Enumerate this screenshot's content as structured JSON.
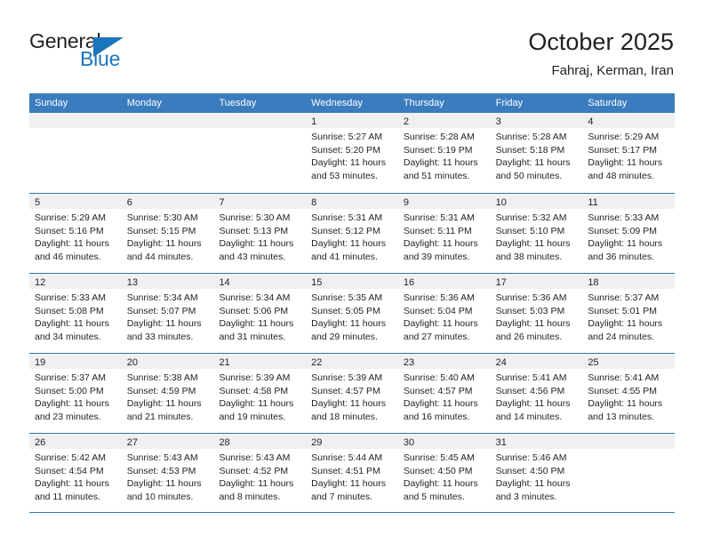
{
  "header": {
    "logo": {
      "word1": "General",
      "word2": "Blue",
      "accent_color": "#1b75bb"
    },
    "title": "October 2025",
    "subtitle": "Fahraj, Kerman, Iran"
  },
  "calendar": {
    "header_bg": "#3a7cbe",
    "grid_line_color": "#2f74b5",
    "daynum_bg": "#f0f0f0",
    "weekdays": [
      "Sunday",
      "Monday",
      "Tuesday",
      "Wednesday",
      "Thursday",
      "Friday",
      "Saturday"
    ],
    "weeks": [
      [
        {
          "day": "",
          "lines": []
        },
        {
          "day": "",
          "lines": []
        },
        {
          "day": "",
          "lines": []
        },
        {
          "day": "1",
          "lines": [
            "Sunrise: 5:27 AM",
            "Sunset: 5:20 PM",
            "Daylight: 11 hours",
            "and 53 minutes."
          ]
        },
        {
          "day": "2",
          "lines": [
            "Sunrise: 5:28 AM",
            "Sunset: 5:19 PM",
            "Daylight: 11 hours",
            "and 51 minutes."
          ]
        },
        {
          "day": "3",
          "lines": [
            "Sunrise: 5:28 AM",
            "Sunset: 5:18 PM",
            "Daylight: 11 hours",
            "and 50 minutes."
          ]
        },
        {
          "day": "4",
          "lines": [
            "Sunrise: 5:29 AM",
            "Sunset: 5:17 PM",
            "Daylight: 11 hours",
            "and 48 minutes."
          ]
        }
      ],
      [
        {
          "day": "5",
          "lines": [
            "Sunrise: 5:29 AM",
            "Sunset: 5:16 PM",
            "Daylight: 11 hours",
            "and 46 minutes."
          ]
        },
        {
          "day": "6",
          "lines": [
            "Sunrise: 5:30 AM",
            "Sunset: 5:15 PM",
            "Daylight: 11 hours",
            "and 44 minutes."
          ]
        },
        {
          "day": "7",
          "lines": [
            "Sunrise: 5:30 AM",
            "Sunset: 5:13 PM",
            "Daylight: 11 hours",
            "and 43 minutes."
          ]
        },
        {
          "day": "8",
          "lines": [
            "Sunrise: 5:31 AM",
            "Sunset: 5:12 PM",
            "Daylight: 11 hours",
            "and 41 minutes."
          ]
        },
        {
          "day": "9",
          "lines": [
            "Sunrise: 5:31 AM",
            "Sunset: 5:11 PM",
            "Daylight: 11 hours",
            "and 39 minutes."
          ]
        },
        {
          "day": "10",
          "lines": [
            "Sunrise: 5:32 AM",
            "Sunset: 5:10 PM",
            "Daylight: 11 hours",
            "and 38 minutes."
          ]
        },
        {
          "day": "11",
          "lines": [
            "Sunrise: 5:33 AM",
            "Sunset: 5:09 PM",
            "Daylight: 11 hours",
            "and 36 minutes."
          ]
        }
      ],
      [
        {
          "day": "12",
          "lines": [
            "Sunrise: 5:33 AM",
            "Sunset: 5:08 PM",
            "Daylight: 11 hours",
            "and 34 minutes."
          ]
        },
        {
          "day": "13",
          "lines": [
            "Sunrise: 5:34 AM",
            "Sunset: 5:07 PM",
            "Daylight: 11 hours",
            "and 33 minutes."
          ]
        },
        {
          "day": "14",
          "lines": [
            "Sunrise: 5:34 AM",
            "Sunset: 5:06 PM",
            "Daylight: 11 hours",
            "and 31 minutes."
          ]
        },
        {
          "day": "15",
          "lines": [
            "Sunrise: 5:35 AM",
            "Sunset: 5:05 PM",
            "Daylight: 11 hours",
            "and 29 minutes."
          ]
        },
        {
          "day": "16",
          "lines": [
            "Sunrise: 5:36 AM",
            "Sunset: 5:04 PM",
            "Daylight: 11 hours",
            "and 27 minutes."
          ]
        },
        {
          "day": "17",
          "lines": [
            "Sunrise: 5:36 AM",
            "Sunset: 5:03 PM",
            "Daylight: 11 hours",
            "and 26 minutes."
          ]
        },
        {
          "day": "18",
          "lines": [
            "Sunrise: 5:37 AM",
            "Sunset: 5:01 PM",
            "Daylight: 11 hours",
            "and 24 minutes."
          ]
        }
      ],
      [
        {
          "day": "19",
          "lines": [
            "Sunrise: 5:37 AM",
            "Sunset: 5:00 PM",
            "Daylight: 11 hours",
            "and 23 minutes."
          ]
        },
        {
          "day": "20",
          "lines": [
            "Sunrise: 5:38 AM",
            "Sunset: 4:59 PM",
            "Daylight: 11 hours",
            "and 21 minutes."
          ]
        },
        {
          "day": "21",
          "lines": [
            "Sunrise: 5:39 AM",
            "Sunset: 4:58 PM",
            "Daylight: 11 hours",
            "and 19 minutes."
          ]
        },
        {
          "day": "22",
          "lines": [
            "Sunrise: 5:39 AM",
            "Sunset: 4:57 PM",
            "Daylight: 11 hours",
            "and 18 minutes."
          ]
        },
        {
          "day": "23",
          "lines": [
            "Sunrise: 5:40 AM",
            "Sunset: 4:57 PM",
            "Daylight: 11 hours",
            "and 16 minutes."
          ]
        },
        {
          "day": "24",
          "lines": [
            "Sunrise: 5:41 AM",
            "Sunset: 4:56 PM",
            "Daylight: 11 hours",
            "and 14 minutes."
          ]
        },
        {
          "day": "25",
          "lines": [
            "Sunrise: 5:41 AM",
            "Sunset: 4:55 PM",
            "Daylight: 11 hours",
            "and 13 minutes."
          ]
        }
      ],
      [
        {
          "day": "26",
          "lines": [
            "Sunrise: 5:42 AM",
            "Sunset: 4:54 PM",
            "Daylight: 11 hours",
            "and 11 minutes."
          ]
        },
        {
          "day": "27",
          "lines": [
            "Sunrise: 5:43 AM",
            "Sunset: 4:53 PM",
            "Daylight: 11 hours",
            "and 10 minutes."
          ]
        },
        {
          "day": "28",
          "lines": [
            "Sunrise: 5:43 AM",
            "Sunset: 4:52 PM",
            "Daylight: 11 hours",
            "and 8 minutes."
          ]
        },
        {
          "day": "29",
          "lines": [
            "Sunrise: 5:44 AM",
            "Sunset: 4:51 PM",
            "Daylight: 11 hours",
            "and 7 minutes."
          ]
        },
        {
          "day": "30",
          "lines": [
            "Sunrise: 5:45 AM",
            "Sunset: 4:50 PM",
            "Daylight: 11 hours",
            "and 5 minutes."
          ]
        },
        {
          "day": "31",
          "lines": [
            "Sunrise: 5:46 AM",
            "Sunset: 4:50 PM",
            "Daylight: 11 hours",
            "and 3 minutes."
          ]
        },
        {
          "day": "",
          "lines": []
        }
      ]
    ]
  }
}
